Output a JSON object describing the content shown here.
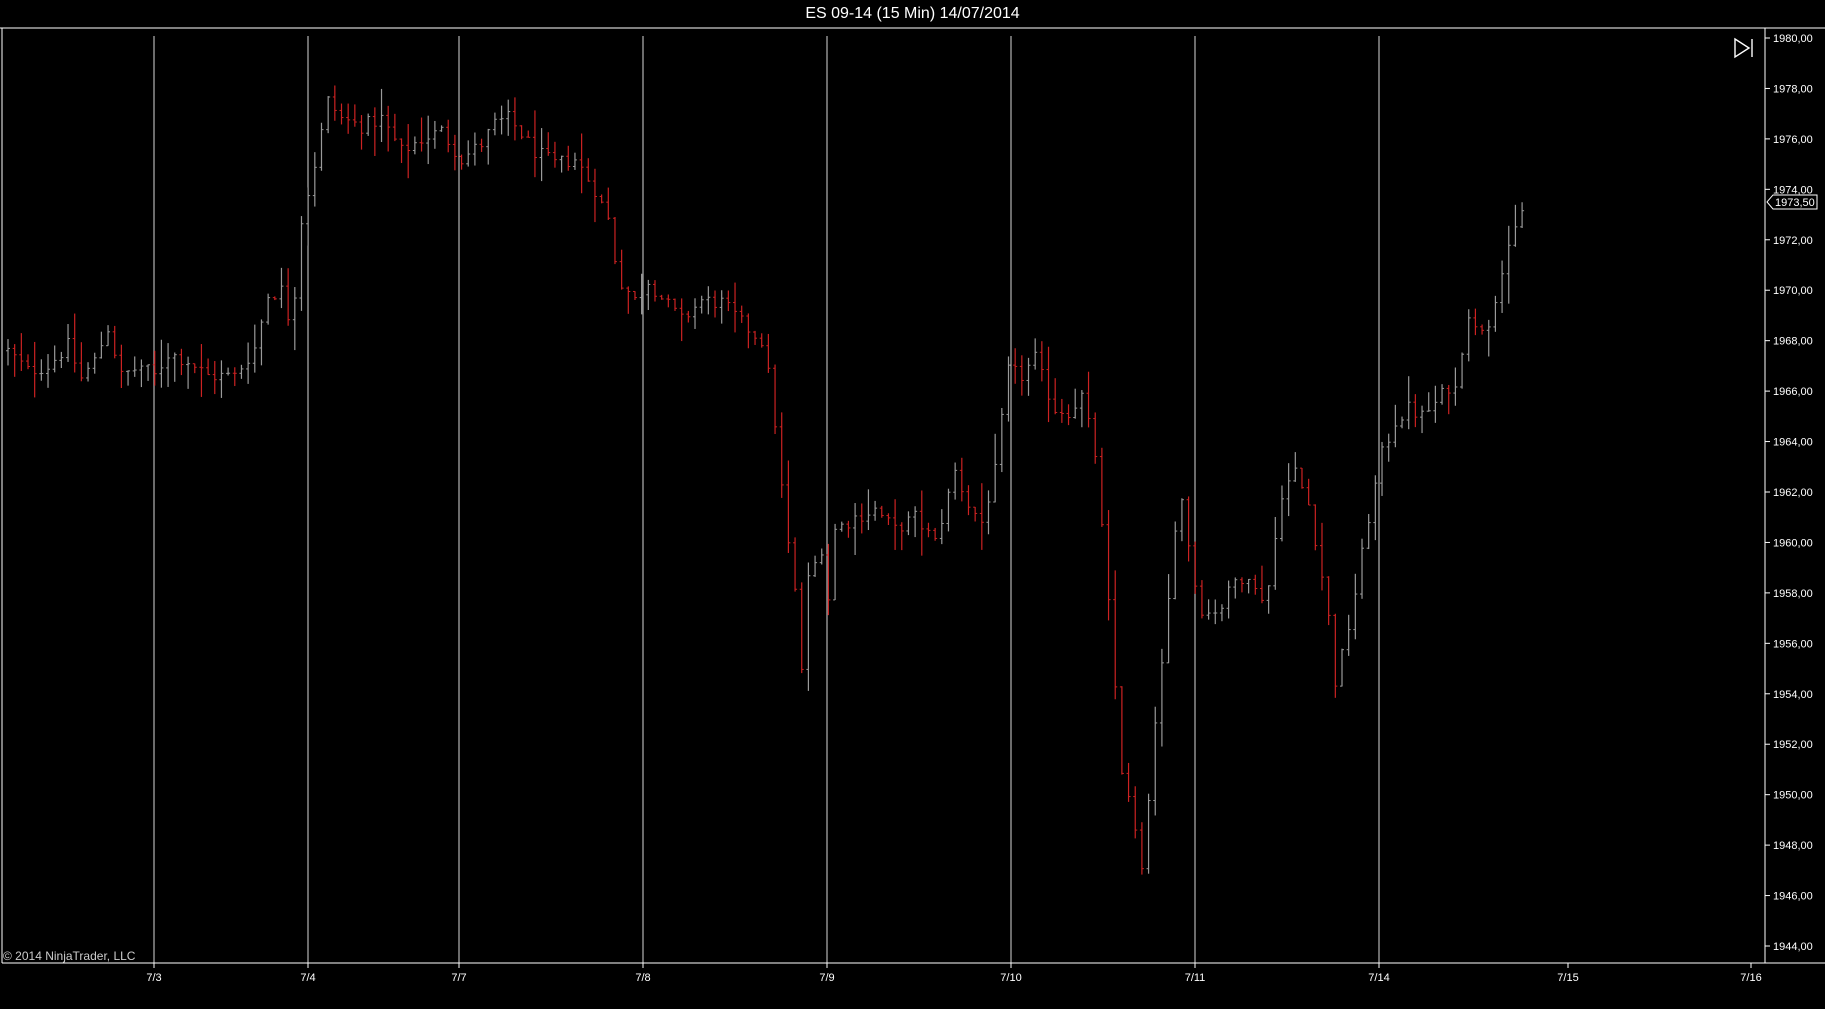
{
  "title": "ES 09-14 (15 Min)  14/07/2014",
  "copyright": "© 2014 NinjaTrader, LLC",
  "colors": {
    "background": "#000000",
    "up_bar": "#9a9a9a",
    "down_bar": "#cc2222",
    "grid": "#ffffff",
    "axis": "#ffffff"
  },
  "icons": {
    "go_to_end": "skip-forward-icon"
  },
  "chart_data": {
    "type": "bar",
    "instrument": "ES 09-14",
    "interval": "15 Min",
    "y_axis": {
      "min": 1944.0,
      "max": 1980.0,
      "tick_labels": [
        "1944,00",
        "1946,00",
        "1948,00",
        "1950,00",
        "1952,00",
        "1954,00",
        "1956,00",
        "1958,00",
        "1960,00",
        "1962,00",
        "1964,00",
        "1966,00",
        "1968,00",
        "1970,00",
        "1972,00",
        "1974,00",
        "1976,00",
        "1978,00",
        "1980,00"
      ]
    },
    "x_axis": {
      "tick_labels": [
        "7/3",
        "7/4",
        "7/7",
        "7/8",
        "7/9",
        "7/10",
        "7/11",
        "7/14",
        "7/15",
        "7/16"
      ],
      "vertical_grid_at": [
        "7/3",
        "7/4",
        "7/7",
        "7/8",
        "7/9",
        "7/10",
        "7/11",
        "7/14"
      ]
    },
    "last_price": "1973,50",
    "grid": true,
    "price_path": [
      [
        0,
        1967.6
      ],
      [
        3,
        1966.8
      ],
      [
        6,
        1967.0
      ],
      [
        9,
        1967.8
      ],
      [
        11,
        1966.5
      ],
      [
        13,
        1967.2
      ],
      [
        15,
        1968.5
      ],
      [
        17,
        1966.6
      ],
      [
        20,
        1967.0
      ],
      [
        22,
        1966.6
      ],
      [
        24,
        1967.5
      ],
      [
        27,
        1967.2
      ],
      [
        30,
        1966.6
      ],
      [
        34,
        1966.6
      ],
      [
        37,
        1967.7
      ],
      [
        39,
        1969.8
      ],
      [
        41,
        1970.0
      ],
      [
        42.5,
        1968.5
      ],
      [
        44,
        1972.8
      ],
      [
        46,
        1975.0
      ],
      [
        48,
        1977.5
      ],
      [
        50,
        1976.8
      ],
      [
        53,
        1976.5
      ],
      [
        56,
        1976.8
      ],
      [
        59,
        1975.5
      ],
      [
        62,
        1976.0
      ],
      [
        65,
        1976.3
      ],
      [
        68,
        1975.2
      ],
      [
        71,
        1975.8
      ],
      [
        73,
        1976.6
      ],
      [
        75,
        1976.8
      ],
      [
        77,
        1976.2
      ],
      [
        79,
        1975.5
      ],
      [
        82,
        1975.0
      ],
      [
        85,
        1975.2
      ],
      [
        88,
        1974.0
      ],
      [
        90,
        1972.8
      ],
      [
        91.5,
        1970.5
      ],
      [
        94,
        1969.6
      ],
      [
        96,
        1970.4
      ],
      [
        98,
        1969.7
      ],
      [
        101,
        1968.8
      ],
      [
        104,
        1969.6
      ],
      [
        107,
        1969.5
      ],
      [
        110,
        1968.7
      ],
      [
        113,
        1968.0
      ],
      [
        114.5,
        1966.0
      ],
      [
        115.5,
        1963.5
      ],
      [
        116.5,
        1960.8
      ],
      [
        118,
        1958.0
      ],
      [
        119,
        1955.0
      ],
      [
        120,
        1958.5
      ],
      [
        122,
        1959.8
      ],
      [
        123,
        1957.8
      ],
      [
        124,
        1960.5
      ],
      [
        127,
        1961.0
      ],
      [
        130,
        1961.3
      ],
      [
        133,
        1960.5
      ],
      [
        136,
        1961.0
      ],
      [
        139,
        1960.0
      ],
      [
        142,
        1962.8
      ],
      [
        144,
        1961.5
      ],
      [
        146,
        1960.8
      ],
      [
        148,
        1962.8
      ],
      [
        150,
        1966.8
      ],
      [
        152,
        1966.6
      ],
      [
        154,
        1967.3
      ],
      [
        155.5,
        1966.2
      ],
      [
        157,
        1965.3
      ],
      [
        159,
        1965.2
      ],
      [
        161,
        1965.8
      ],
      [
        163,
        1963.5
      ],
      [
        165,
        1957.5
      ],
      [
        167,
        1951.0
      ],
      [
        169,
        1948.5
      ],
      [
        170,
        1946.8
      ],
      [
        171.5,
        1951.5
      ],
      [
        173,
        1955.0
      ],
      [
        174.5,
        1959.0
      ],
      [
        175.5,
        1962.5
      ],
      [
        177,
        1960.0
      ],
      [
        178.5,
        1957.5
      ],
      [
        180,
        1957.2
      ],
      [
        182,
        1957.5
      ],
      [
        184,
        1958.5
      ],
      [
        186,
        1958.8
      ],
      [
        187.5,
        1957.7
      ],
      [
        189,
        1958.3
      ],
      [
        191,
        1962.0
      ],
      [
        193,
        1962.8
      ],
      [
        195,
        1961.5
      ],
      [
        196.5,
        1959.5
      ],
      [
        198,
        1957.0
      ],
      [
        199,
        1954.5
      ],
      [
        200.5,
        1956.0
      ],
      [
        202,
        1958.0
      ],
      [
        204,
        1961.0
      ],
      [
        206,
        1963.5
      ],
      [
        208,
        1964.8
      ],
      [
        210,
        1965.3
      ],
      [
        212,
        1965.0
      ],
      [
        214,
        1965.5
      ],
      [
        216,
        1966.2
      ],
      [
        217.5,
        1966.0
      ],
      [
        218.5,
        1969.5
      ],
      [
        220,
        1968.4
      ],
      [
        222,
        1968.8
      ],
      [
        223.5,
        1970.3
      ],
      [
        225,
        1971.5
      ],
      [
        226.5,
        1972.8
      ],
      [
        227.5,
        1973.5
      ]
    ]
  }
}
